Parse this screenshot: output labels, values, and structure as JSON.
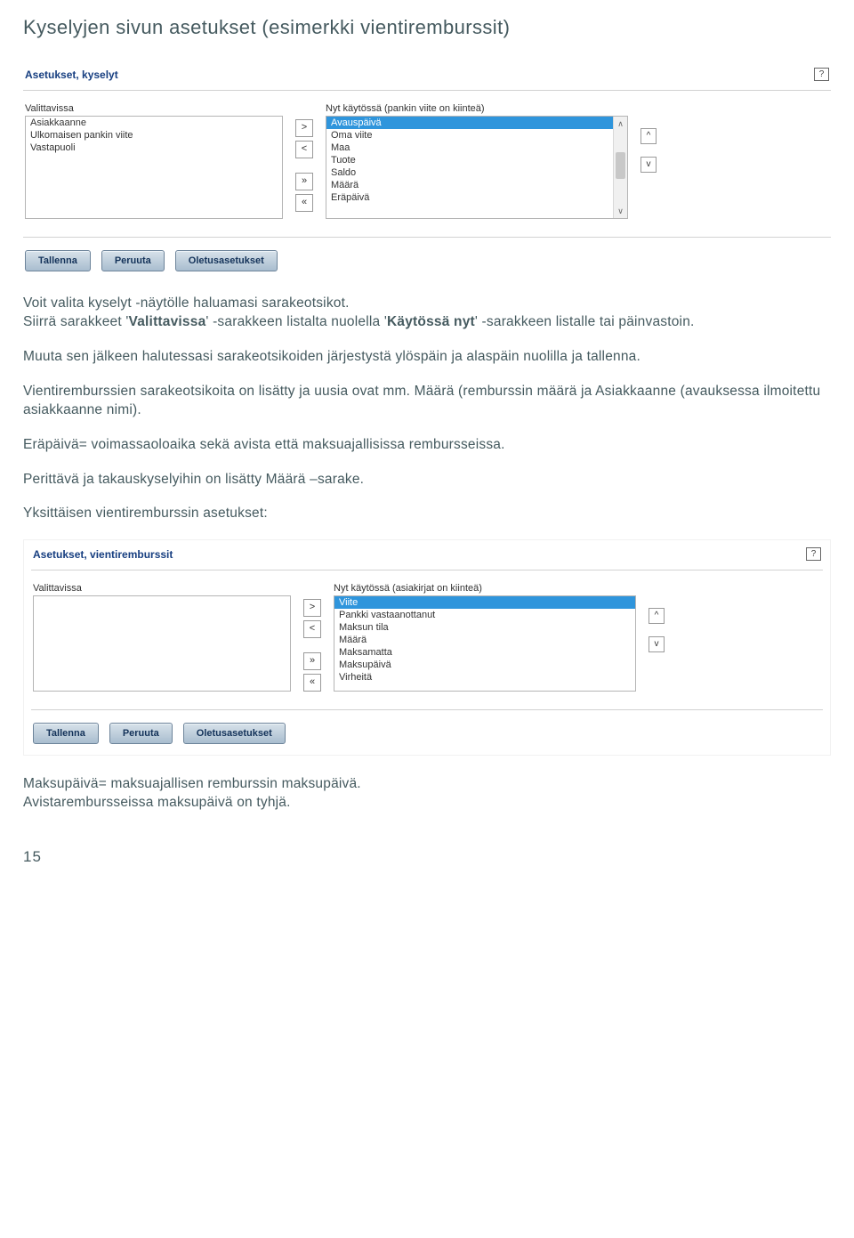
{
  "title": "Kyselyjen sivun asetukset (esimerkki vientiremburssit)",
  "panel1": {
    "title": "Asetukset, kyselyt",
    "leftLabel": "Valittavissa",
    "rightLabel": "Nyt käytössä (pankin viite on kiinteä)",
    "leftItems": [
      "Asiakkaanne",
      "Ulkomaisen pankin viite",
      "Vastapuoli"
    ],
    "rightItems": [
      "Avauspäivä",
      "Oma viite",
      "Maa",
      "Tuote",
      "Saldo",
      "Määrä",
      "Eräpäivä"
    ],
    "selectedRight": "Avauspäivä"
  },
  "buttons": {
    "save": "Tallenna",
    "cancel": "Peruuta",
    "defaults": "Oletusasetukset"
  },
  "moveBtns": {
    "right": ">",
    "left": "<",
    "allRight": "»",
    "allLeft": "«"
  },
  "reorder": {
    "up": "^",
    "down": "v"
  },
  "body": {
    "p1a": "Voit valita kyselyt -näytölle haluamasi sarakeotsikot.",
    "p1b_1": "Siirrä sarakkeet '",
    "p1b_bold1": "Valittavissa",
    "p1b_2": "' -sarakkeen listalta nuolella '",
    "p1b_bold2": "Käytössä nyt",
    "p1b_3": "' -sarakkeen listalle tai päinvastoin.",
    "p2": "Muuta sen jälkeen halutessasi sarakeotsikoiden järjestystä ylöspäin ja alaspäin nuolilla ja tallenna.",
    "p3": "Vientiremburssien sarakeotsikoita on lisätty ja uusia ovat mm.  Määrä (remburssin määrä ja Asiakkaanne (avauksessa ilmoitettu asiakkaanne nimi).",
    "p4": "Eräpäivä= voimassaoloaika sekä avista että maksuajallisissa rembursseissa.",
    "p5": "Perittävä  ja takauskyselyihin on lisätty Määrä –sarake.",
    "p6": "Yksittäisen vientiremburssin asetukset:"
  },
  "panel2": {
    "title": "Asetukset, vientiremburssit",
    "leftLabel": "Valittavissa",
    "rightLabel": "Nyt käytössä (asiakirjat on kiinteä)",
    "rightItems": [
      "Viite",
      "Pankki vastaanottanut",
      "Maksun tila",
      "Määrä",
      "Maksamatta",
      "Maksupäivä",
      "Virheitä"
    ],
    "selectedRight": "Viite"
  },
  "footer": {
    "p1": "Maksupäivä= maksuajallisen remburssin maksupäivä.",
    "p2": "Avistarembursseissa maksupäivä on tyhjä."
  },
  "pageNumber": "15"
}
